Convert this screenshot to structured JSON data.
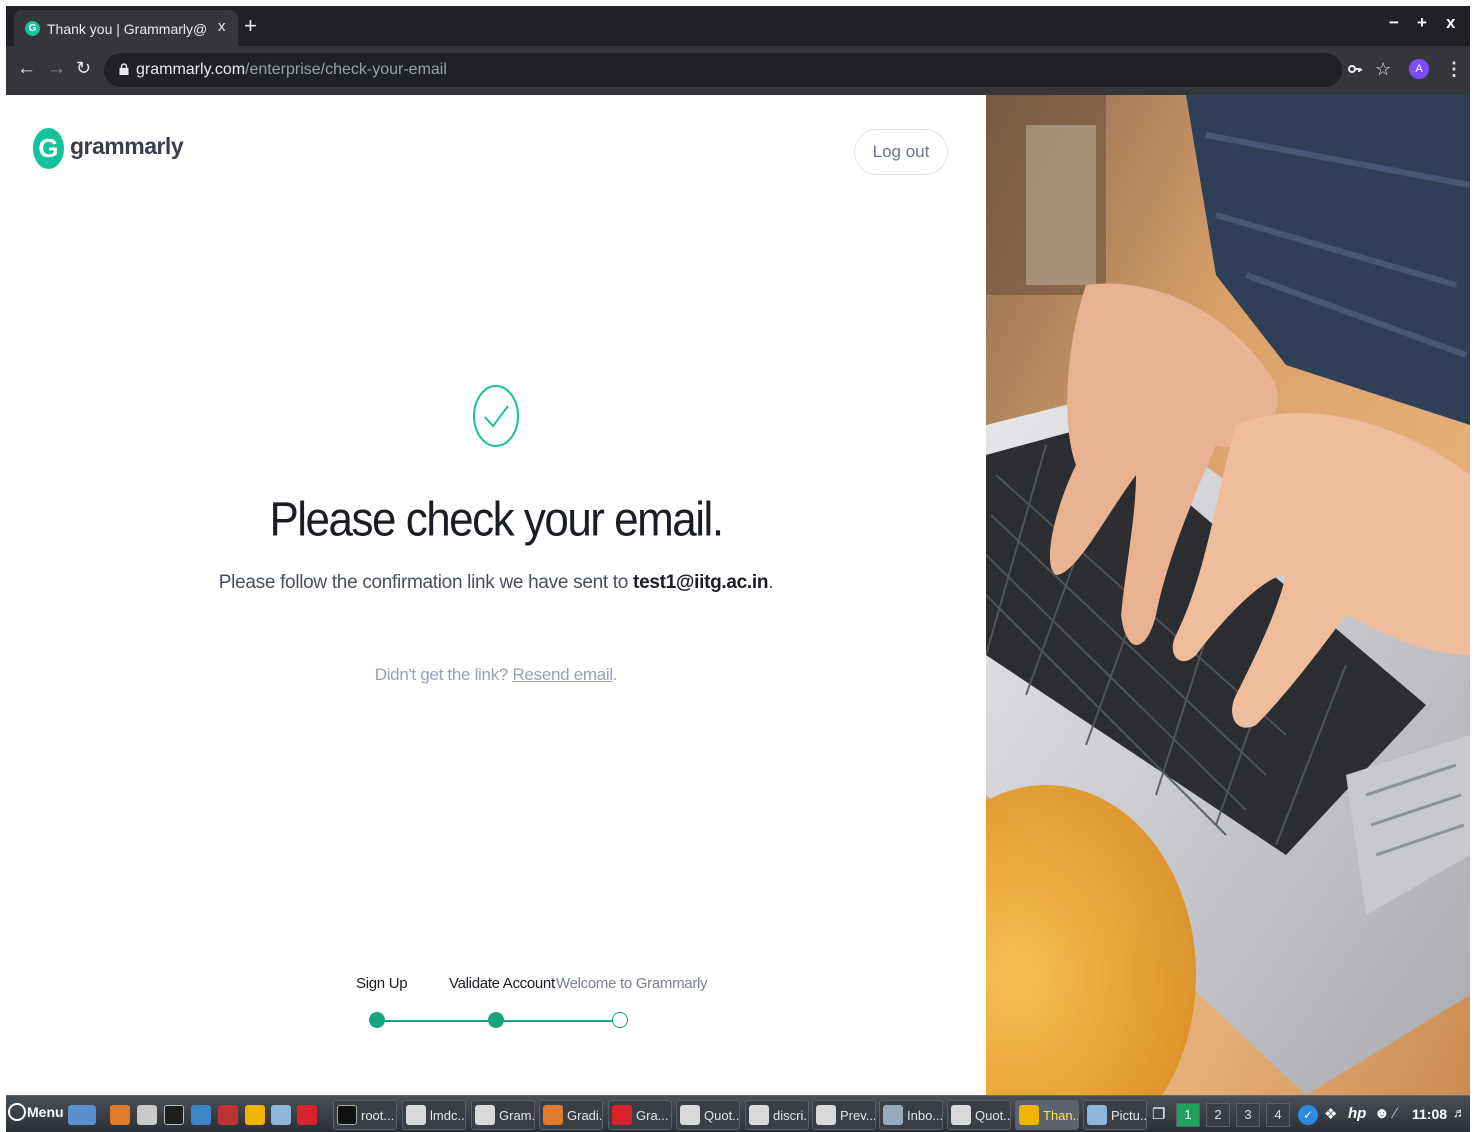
{
  "browser": {
    "tab_title": "Thank you | Grammarly@E",
    "tab_close": "x",
    "tab_favicon": "G",
    "new_tab": "+",
    "window_controls": {
      "minimize": "−",
      "maximize": "+",
      "close": "x"
    },
    "url_host": "grammarly.com",
    "url_path": "/enterprise/check-your-email",
    "profile_initial": "A"
  },
  "page": {
    "logo_mark": "G",
    "logo_text": "grammarly",
    "logout_label": "Log out",
    "heading": "Please check your email.",
    "subtext_prefix": "Please follow the confirmation link we have sent to ",
    "email": "test1@iitg.ac.in",
    "subtext_suffix": ".",
    "resend_prefix": "Didn't get the link? ",
    "resend_link": "Resend email",
    "resend_suffix": ".",
    "steps": [
      {
        "label": "Sign Up",
        "state": "done"
      },
      {
        "label": "Validate Account",
        "state": "done"
      },
      {
        "label": "Welcome to Grammarly",
        "state": "todo"
      }
    ],
    "accent_color": "#15c39a"
  },
  "taskbar": {
    "menu_label": "Menu",
    "tasks": [
      {
        "label": "root...",
        "icon": "terminal-icon"
      },
      {
        "label": "lmdc...",
        "icon": "pdf-reader-icon"
      },
      {
        "label": "Gram...",
        "icon": "pdf-reader-icon"
      },
      {
        "label": "Gradi...",
        "icon": "firefox-icon"
      },
      {
        "label": "Gra...",
        "icon": "opera-icon"
      },
      {
        "label": "Quot...",
        "icon": "pdf-reader-icon"
      },
      {
        "label": "discri...",
        "icon": "pdf-reader-icon"
      },
      {
        "label": "Prev...",
        "icon": "pdf-reader-icon"
      },
      {
        "label": "Inbo...",
        "icon": "mail-icon"
      },
      {
        "label": "Quot...",
        "icon": "pdf-reader-icon"
      },
      {
        "label": "Than...",
        "icon": "chrome-icon"
      },
      {
        "label": "Pictu...",
        "icon": "folder-icon"
      }
    ],
    "workspaces": [
      "1",
      "2",
      "3",
      "4"
    ],
    "active_workspace": "1",
    "clock": "11:08"
  }
}
